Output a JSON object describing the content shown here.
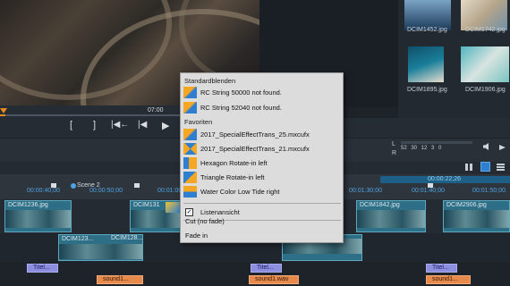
{
  "preview": {
    "timecode": "07:00"
  },
  "media_bin": {
    "items": [
      {
        "label": "DCIM1452.jpg"
      },
      {
        "label": "DCIM1742.jpg"
      },
      {
        "label": "DCIM1895.jpg"
      },
      {
        "label": "DCIM1906.jpg"
      }
    ]
  },
  "transport": {
    "mark_in": "[",
    "mark_out": "]",
    "to_start": "|◀←",
    "prev": "|◀",
    "play": "▶"
  },
  "mixer": {
    "l_label": "L",
    "r_label": "R",
    "scale": "52 30 12 3 0"
  },
  "timeline": {
    "scene_label": "Scene 2",
    "timecodes": [
      "00:00:40;00",
      "00:00:50;00",
      "00:01:00",
      "00:01:30;00",
      "00:01:40;00",
      "00:01:50;00"
    ],
    "position_timecode": "00:00:22;26",
    "clips_row1": [
      {
        "label": "DCIM1236.jpg"
      },
      {
        "label": "DCIM131"
      },
      {
        "label": "DCIM1842.jpg"
      },
      {
        "label": "DCIM2906.jpg"
      }
    ],
    "clips_row2": [
      {
        "label": "DCIM123..."
      },
      {
        "label": "DCIM128..."
      }
    ],
    "titles": [
      "Titel...",
      "Titel...",
      "Titel..."
    ],
    "sounds": [
      "sound1...",
      "sound1.wav",
      "sound1..."
    ]
  },
  "context_menu": {
    "header_standard": "Standardblenden",
    "standard_items": [
      {
        "label": "RC String 50000 not found."
      },
      {
        "label": "RC String 52040 not found."
      }
    ],
    "header_favorites": "Favoriten",
    "favorite_items": [
      {
        "label": "2017_SpecialEffectTrans_25.mxcufx"
      },
      {
        "label": "2017_SpecialEffectTrans_21.mxcufx"
      },
      {
        "label": "Hexagon Rotate-in left"
      },
      {
        "label": "Triangle Rotate-in left"
      },
      {
        "label": "Water Color Low Tide right"
      }
    ],
    "listenansicht": {
      "label": "Listenansicht",
      "checked": true
    },
    "cut_no_fade": "Cut (no fade)",
    "fade_in": "Fade in"
  }
}
